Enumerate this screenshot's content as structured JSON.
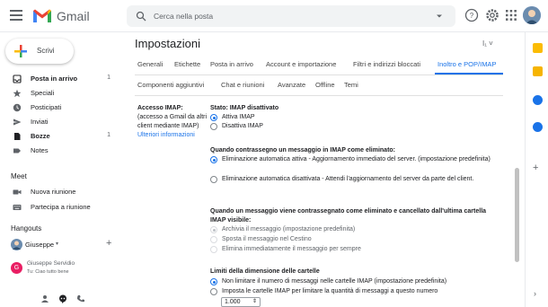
{
  "app": {
    "logo_text": "Gmail"
  },
  "search": {
    "placeholder": "Cerca nella posta"
  },
  "compose": {
    "label": "Scrivi"
  },
  "sidebar": {
    "items": [
      {
        "label": "Posta in arrivo",
        "count": "1",
        "icon": "inbox-icon",
        "bold": true
      },
      {
        "label": "Speciali",
        "count": "",
        "icon": "star-icon",
        "bold": false
      },
      {
        "label": "Posticipati",
        "count": "",
        "icon": "clock-icon",
        "bold": false
      },
      {
        "label": "Inviati",
        "count": "",
        "icon": "send-icon",
        "bold": false
      },
      {
        "label": "Bozze",
        "count": "1",
        "icon": "draft-icon",
        "bold": true
      },
      {
        "label": "Notes",
        "count": "",
        "icon": "label-icon",
        "bold": false
      }
    ],
    "meet": {
      "title": "Meet",
      "items": [
        {
          "label": "Nuova riunione",
          "icon": "video-icon"
        },
        {
          "label": "Partecipa a riunione",
          "icon": "keyboard-icon"
        }
      ]
    },
    "hangouts": {
      "title": "Hangouts",
      "user": "Giuseppe",
      "contact_name": "Giuseppe Servidio",
      "contact_message": "Tu: Ciao tutto bene"
    }
  },
  "settings": {
    "title": "Impostazioni",
    "lang_icon": "I₁ ˅",
    "tabs_row1": [
      "Generali",
      "Etichette",
      "Posta in arrivo",
      "Account e importazione",
      "Filtri e indirizzi bloccati",
      "Inoltro e POP/IMAP"
    ],
    "tabs_row2": [
      "Componenti aggiuntivi",
      "Chat e riunioni",
      "Avanzate",
      "Offline",
      "Temi"
    ],
    "active_tab": "Inoltro e POP/IMAP",
    "imap": {
      "label_title": "Accesso IMAP:",
      "label_desc": "(accesso a Gmail da altri client mediante IMAP)",
      "link": "Ulteriori informazioni",
      "status": "Stato: IMAP disattivato",
      "enable": "Attiva IMAP",
      "disable": "Disattiva IMAP",
      "deleted_heading": "Quando contrassegno un messaggio in IMAP come eliminato:",
      "deleted_opt1": "Eliminazione automatica attiva - Aggiornamento immediato del server. (impostazione predefinita)",
      "deleted_opt2": "Eliminazione automatica disattivata - Attendi l'aggiornamento del server da parte del client.",
      "expunge_heading": "Quando un messaggio viene contrassegnato come eliminato e cancellato dall'ultima cartella IMAP visibile:",
      "expunge_opt1": "Archivia il messaggio (impostazione predefinita)",
      "expunge_opt2": "Sposta il messaggio nel Cestino",
      "expunge_opt3": "Elimina immediatamente il messaggio per sempre",
      "limits_heading": "Limiti della dimensione delle cartelle",
      "limits_opt1": "Non limitare il numero di messaggi nelle cartelle IMAP (impostazione predefinita)",
      "limits_opt2": "Imposta le cartelle IMAP per limitare la quantità di messaggi a questo numero",
      "limit_value": "1.000"
    }
  },
  "colors": {
    "accent": "#1a73e8",
    "gmail_red": "#ea4335"
  }
}
